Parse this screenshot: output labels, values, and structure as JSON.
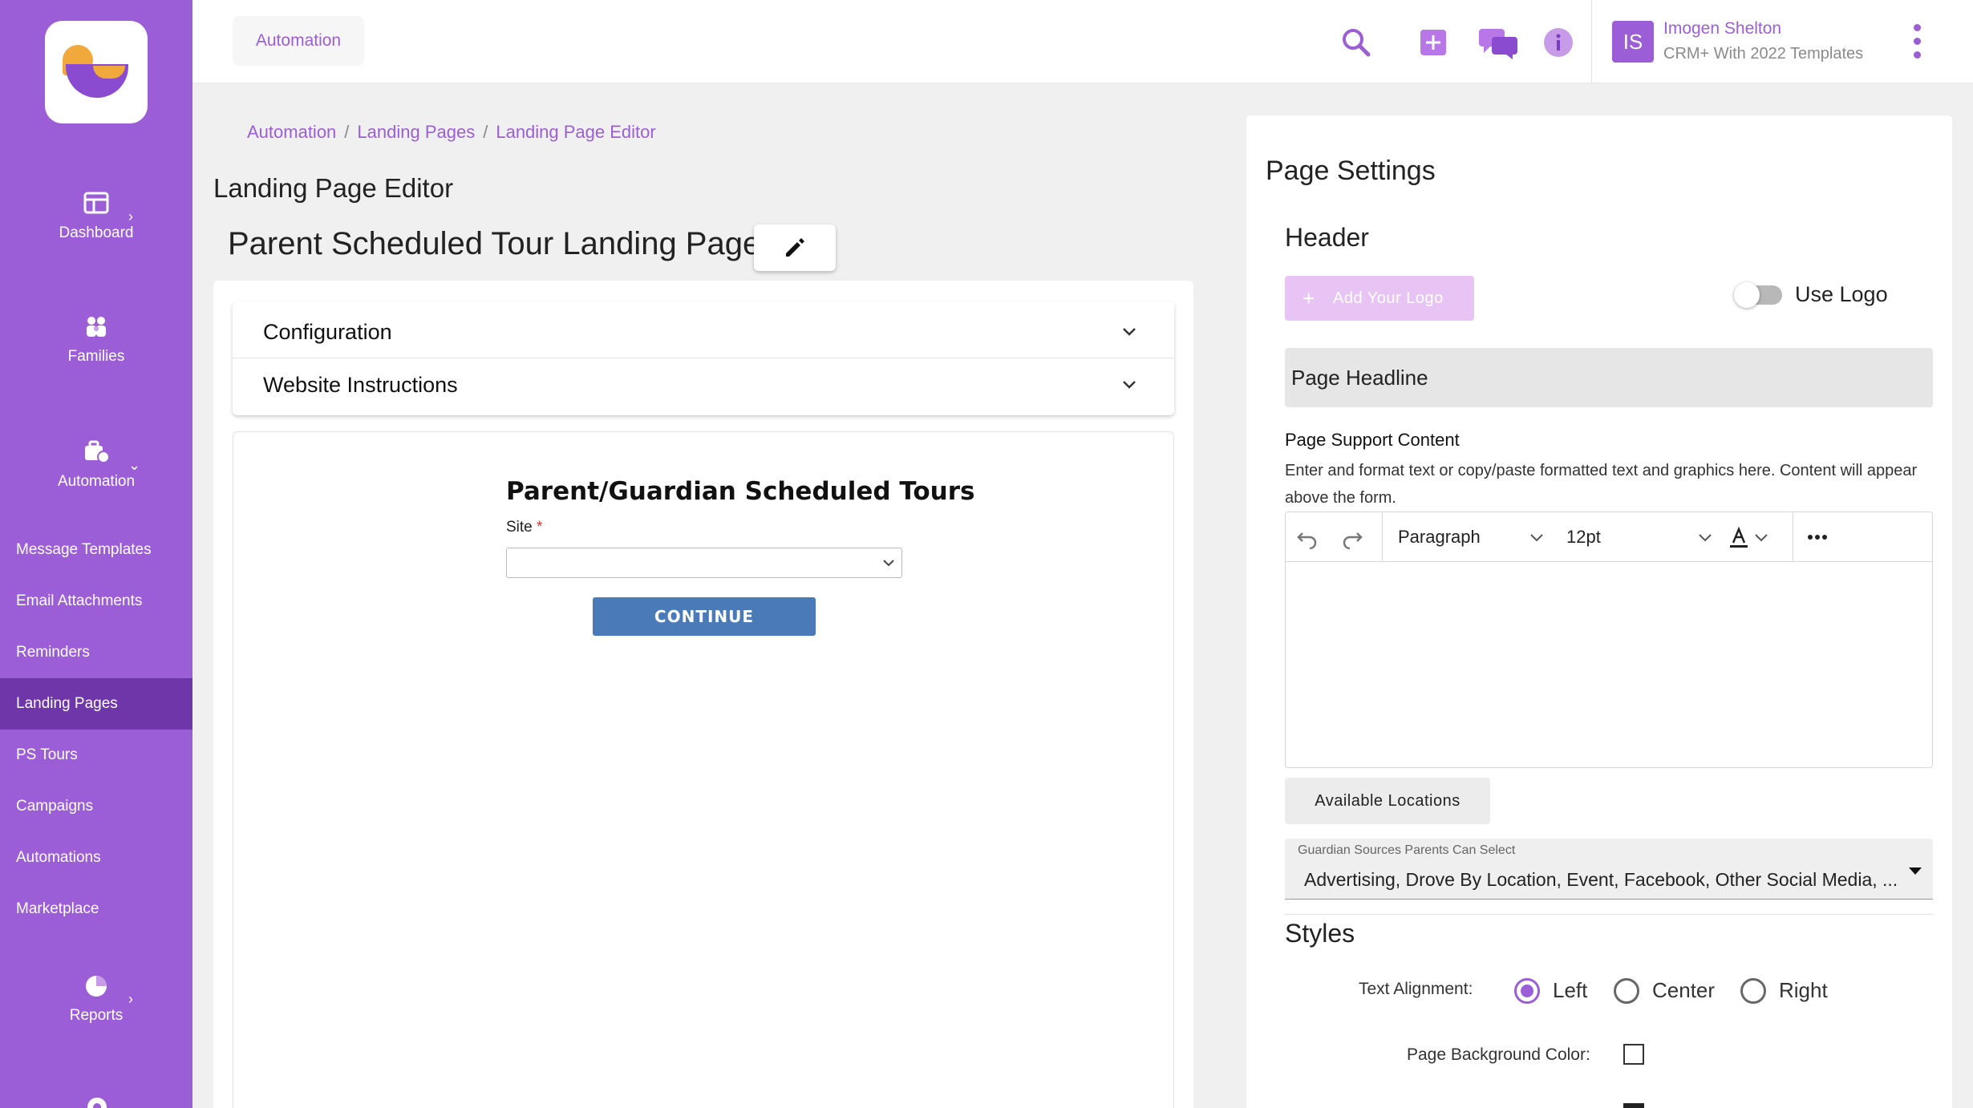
{
  "sidebar": {
    "main_items": [
      {
        "label": "Dashboard",
        "icon": "dashboard-icon",
        "has_chevron": true
      },
      {
        "label": "Families",
        "icon": "families-icon",
        "has_chevron": false
      },
      {
        "label": "Automation",
        "icon": "automation-icon",
        "has_chevron": true
      },
      {
        "label": "Reports",
        "icon": "reports-icon",
        "has_chevron": true
      }
    ],
    "sub_items": [
      {
        "label": "Message Templates"
      },
      {
        "label": "Email Attachments"
      },
      {
        "label": "Reminders"
      },
      {
        "label": "Landing Pages",
        "active": true
      },
      {
        "label": "PS Tours"
      },
      {
        "label": "Campaigns"
      },
      {
        "label": "Automations"
      },
      {
        "label": "Marketplace"
      }
    ],
    "colors": {
      "background": "#9c5ed6",
      "active": "#6e36a8"
    }
  },
  "topbar": {
    "chip_label": "Automation",
    "icons": [
      "search-icon",
      "add-icon",
      "chat-icon",
      "info-icon"
    ],
    "user": {
      "initials": "IS",
      "name": "Imogen Shelton",
      "subtitle": "CRM+ With 2022 Templates"
    }
  },
  "breadcrumb": [
    "Automation",
    "Landing Pages",
    "Landing Page Editor"
  ],
  "page_title": "Landing Page Editor",
  "landing_page_title": "Parent Scheduled Tour Landing Page",
  "accordion": [
    {
      "label": "Configuration"
    },
    {
      "label": "Website Instructions"
    }
  ],
  "preview": {
    "title": "Parent/Guardian Scheduled Tours",
    "site_label": "Site",
    "required_mark": "*",
    "site_value": "",
    "continue_label": "CONTINUE",
    "button_color": "#4a7ab8"
  },
  "settings": {
    "title": "Page Settings",
    "header_label": "Header",
    "add_logo_label": "Add Your Logo",
    "use_logo_label": "Use Logo",
    "use_logo_on": false,
    "headline_placeholder": "Page Headline",
    "support_label": "Page Support Content",
    "support_desc": "Enter and format text or copy/paste formatted text and graphics here. Content will appear above the form.",
    "toolbar": {
      "block_format": "Paragraph",
      "font_size": "12pt"
    },
    "available_locations_label": "Available Locations",
    "sources": {
      "label": "Guardian Sources Parents Can Select",
      "value": "Advertising, Drove By Location, Event, Facebook, Other Social Media, ..."
    },
    "styles_label": "Styles",
    "text_alignment_label": "Text Alignment:",
    "alignment_options": [
      "Left",
      "Center",
      "Right"
    ],
    "alignment_selected": "Left",
    "bg_color_label": "Page Background Color:"
  }
}
